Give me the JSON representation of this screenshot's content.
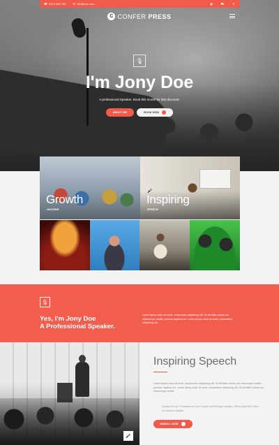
{
  "topbar": {
    "phone": "0123 456 789",
    "email": "info@cob.com",
    "icons": [
      "grid-icon",
      "cart-icon",
      "search-icon"
    ]
  },
  "header": {
    "logo_mark": "C",
    "logo_light": "CONFER",
    "logo_bold": "PRESS"
  },
  "hero": {
    "title": "I'm Jony Doe",
    "subtitle": "A professional Speaker. Book this month for $30 discount.",
    "about_button": "ABOUT ME",
    "book_button": "BOOK NOW"
  },
  "gallery": {
    "tiles": [
      {
        "label": "Growth",
        "sub": "HACKING"
      },
      {
        "label": "Inspiring",
        "sub": "SPEECH"
      }
    ]
  },
  "band": {
    "title_line1": "Yes, I'm Jony Doe",
    "title_line2": "A Professional Speaker.",
    "text": "Lorem ipsum dolor sit amet, consectetur adipiscing elit. Ut elit tellus luctus nec ullamcorper mattis, pulvinar dapibus leo. Lorem ipsum dolor sit amet, consectetur adipiscing elit."
  },
  "speech": {
    "title": "Inspiring Speech",
    "text": "Lorem ipsum dolor sit amet, consectetur adipiscing elit. Ut elit tellus luctus nec ullamcorper mattis, pulvinar dapibus leo. Lorem ipsum dolor sit amet, consectetur adipiscing elit. Ut elit tellus luctus nec ullamcorper mattis.",
    "quote": "Quisque et dui. Phasellus nec sem in justo pellentesque facilisis. Etiam imperdiet, tellus eu suscipit volutpat.",
    "enroll_button": "ENROLL NOW"
  },
  "colors": {
    "accent": "#f25a4a",
    "band": "#f35d4e"
  }
}
